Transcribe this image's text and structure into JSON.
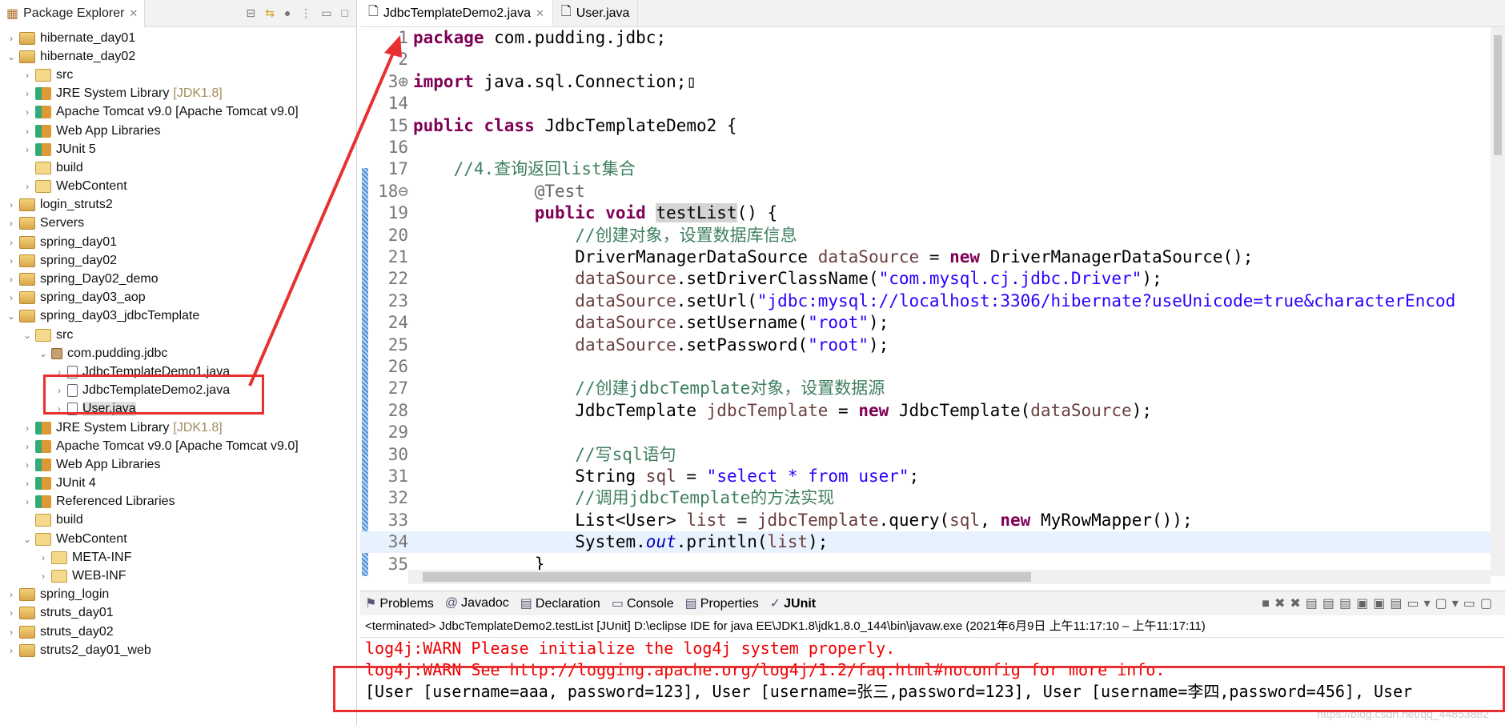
{
  "explorer": {
    "title": "Package Explorer",
    "items": [
      {
        "label": "hibernate_day01",
        "level": 0,
        "tw": ">",
        "icon": "proj"
      },
      {
        "label": "hibernate_day02",
        "level": 0,
        "tw": "v",
        "icon": "proj"
      },
      {
        "label": "src",
        "level": 1,
        "tw": ">",
        "icon": "folder"
      },
      {
        "label": "JRE System Library",
        "extra": "[JDK1.8]",
        "level": 1,
        "tw": ">",
        "icon": "lib"
      },
      {
        "label": "Apache Tomcat v9.0 [Apache Tomcat v9.0]",
        "level": 1,
        "tw": ">",
        "icon": "lib"
      },
      {
        "label": "Web App Libraries",
        "level": 1,
        "tw": ">",
        "icon": "lib"
      },
      {
        "label": "JUnit 5",
        "level": 1,
        "tw": ">",
        "icon": "lib"
      },
      {
        "label": "build",
        "level": 1,
        "tw": "",
        "icon": "folder"
      },
      {
        "label": "WebContent",
        "level": 1,
        "tw": ">",
        "icon": "folder"
      },
      {
        "label": "login_struts2",
        "level": 0,
        "tw": ">",
        "icon": "proj"
      },
      {
        "label": "Servers",
        "level": 0,
        "tw": ">",
        "icon": "proj"
      },
      {
        "label": "spring_day01",
        "level": 0,
        "tw": ">",
        "icon": "proj"
      },
      {
        "label": "spring_day02",
        "level": 0,
        "tw": ">",
        "icon": "proj"
      },
      {
        "label": "spring_Day02_demo",
        "level": 0,
        "tw": ">",
        "icon": "proj"
      },
      {
        "label": "spring_day03_aop",
        "level": 0,
        "tw": ">",
        "icon": "proj"
      },
      {
        "label": "spring_day03_jdbcTemplate",
        "level": 0,
        "tw": "v",
        "icon": "proj"
      },
      {
        "label": "src",
        "level": 1,
        "tw": "v",
        "icon": "folder"
      },
      {
        "label": "com.pudding.jdbc",
        "level": 2,
        "tw": "v",
        "icon": "pkg"
      },
      {
        "label": "JdbcTemplateDemo1.java",
        "level": 3,
        "tw": ">",
        "icon": "java"
      },
      {
        "label": "JdbcTemplateDemo2.java",
        "level": 3,
        "tw": ">",
        "icon": "java"
      },
      {
        "label": "User.java",
        "level": 3,
        "tw": ">",
        "icon": "java",
        "selected": true
      },
      {
        "label": "JRE System Library",
        "extra": "[JDK1.8]",
        "level": 1,
        "tw": ">",
        "icon": "lib"
      },
      {
        "label": "Apache Tomcat v9.0 [Apache Tomcat v9.0]",
        "level": 1,
        "tw": ">",
        "icon": "lib"
      },
      {
        "label": "Web App Libraries",
        "level": 1,
        "tw": ">",
        "icon": "lib"
      },
      {
        "label": "JUnit 4",
        "level": 1,
        "tw": ">",
        "icon": "lib"
      },
      {
        "label": "Referenced Libraries",
        "level": 1,
        "tw": ">",
        "icon": "lib"
      },
      {
        "label": "build",
        "level": 1,
        "tw": "",
        "icon": "folder"
      },
      {
        "label": "WebContent",
        "level": 1,
        "tw": "v",
        "icon": "folder"
      },
      {
        "label": "META-INF",
        "level": 2,
        "tw": ">",
        "icon": "folder"
      },
      {
        "label": "WEB-INF",
        "level": 2,
        "tw": ">",
        "icon": "folder"
      },
      {
        "label": "spring_login",
        "level": 0,
        "tw": ">",
        "icon": "proj"
      },
      {
        "label": "struts_day01",
        "level": 0,
        "tw": ">",
        "icon": "proj"
      },
      {
        "label": "struts_day02",
        "level": 0,
        "tw": ">",
        "icon": "proj"
      },
      {
        "label": "struts2_day01_web",
        "level": 0,
        "tw": ">",
        "icon": "proj"
      }
    ]
  },
  "editor": {
    "tabs": [
      "JdbcTemplateDemo2.java",
      "User.java"
    ],
    "current_line": "34",
    "lines": [
      {
        "n": "1",
        "t": [
          [
            "package",
            "kw"
          ],
          [
            " com.pudding.jdbc;",
            ""
          ]
        ]
      },
      {
        "n": "2",
        "t": []
      },
      {
        "n": "3⊕",
        "t": [
          [
            "import",
            "kw"
          ],
          [
            " java.sql.Connection;▯",
            ""
          ]
        ]
      },
      {
        "n": "14",
        "t": []
      },
      {
        "n": "15",
        "t": [
          [
            "public class",
            "kw"
          ],
          [
            " JdbcTemplateDemo2 {",
            ""
          ]
        ]
      },
      {
        "n": "16",
        "t": []
      },
      {
        "n": "17",
        "t": [
          [
            "    //4.查询返回list集合",
            "cm"
          ]
        ]
      },
      {
        "n": "18⊖",
        "t": [
          [
            "            @Test",
            "ann"
          ]
        ]
      },
      {
        "n": "19",
        "t": [
          [
            "            ",
            ""
          ],
          [
            "public void",
            "kw"
          ],
          [
            " ",
            ""
          ],
          [
            "testList",
            "hl"
          ],
          [
            "() {",
            ""
          ]
        ]
      },
      {
        "n": "20",
        "t": [
          [
            "                //创建对象，设置数据库信息",
            "cm"
          ]
        ]
      },
      {
        "n": "21",
        "t": [
          [
            "                DriverManagerDataSource ",
            ""
          ],
          [
            "dataSource",
            "var"
          ],
          [
            " = ",
            ""
          ],
          [
            "new",
            "kw"
          ],
          [
            " DriverManagerDataSource();",
            ""
          ]
        ]
      },
      {
        "n": "22",
        "t": [
          [
            "                ",
            ""
          ],
          [
            "dataSource",
            "var"
          ],
          [
            ".setDriverClassName(",
            ""
          ],
          [
            "\"com.mysql.cj.jdbc.Driver\"",
            "str"
          ],
          [
            ");",
            ""
          ]
        ]
      },
      {
        "n": "23",
        "t": [
          [
            "                ",
            ""
          ],
          [
            "dataSource",
            "var"
          ],
          [
            ".setUrl(",
            ""
          ],
          [
            "\"jdbc:mysql://localhost:3306/hibernate?useUnicode=true&characterEncod",
            "str"
          ]
        ]
      },
      {
        "n": "24",
        "t": [
          [
            "                ",
            ""
          ],
          [
            "dataSource",
            "var"
          ],
          [
            ".setUsername(",
            ""
          ],
          [
            "\"root\"",
            "str"
          ],
          [
            ");",
            ""
          ]
        ]
      },
      {
        "n": "25",
        "t": [
          [
            "                ",
            ""
          ],
          [
            "dataSource",
            "var"
          ],
          [
            ".setPassword(",
            ""
          ],
          [
            "\"root\"",
            "str"
          ],
          [
            ");",
            ""
          ]
        ]
      },
      {
        "n": "26",
        "t": []
      },
      {
        "n": "27",
        "t": [
          [
            "                //创建jdbcTemplate对象，设置数据源",
            "cm"
          ]
        ]
      },
      {
        "n": "28",
        "t": [
          [
            "                JdbcTemplate ",
            ""
          ],
          [
            "jdbcTemplate",
            "var"
          ],
          [
            " = ",
            ""
          ],
          [
            "new",
            "kw"
          ],
          [
            " JdbcTemplate(",
            ""
          ],
          [
            "dataSource",
            "var"
          ],
          [
            ");",
            ""
          ]
        ]
      },
      {
        "n": "29",
        "t": []
      },
      {
        "n": "30",
        "t": [
          [
            "                //写sql语句",
            "cm"
          ]
        ]
      },
      {
        "n": "31",
        "t": [
          [
            "                String ",
            ""
          ],
          [
            "sql",
            "var"
          ],
          [
            " = ",
            ""
          ],
          [
            "\"select * from user\"",
            "str"
          ],
          [
            ";",
            ""
          ]
        ]
      },
      {
        "n": "32",
        "t": [
          [
            "                //调用jdbcTemplate的方法实现",
            "cm"
          ]
        ]
      },
      {
        "n": "33",
        "t": [
          [
            "                List<User> ",
            ""
          ],
          [
            "list",
            "var"
          ],
          [
            " = ",
            ""
          ],
          [
            "jdbcTemplate",
            "var"
          ],
          [
            ".query(",
            ""
          ],
          [
            "sql",
            "var"
          ],
          [
            ", ",
            ""
          ],
          [
            "new",
            "kw"
          ],
          [
            " MyRowMapper());",
            ""
          ]
        ]
      },
      {
        "n": "34",
        "t": [
          [
            "                System.",
            ""
          ],
          [
            "out",
            "fld"
          ],
          [
            ".println(",
            ""
          ],
          [
            "list",
            "var"
          ],
          [
            ");",
            ""
          ]
        ]
      },
      {
        "n": "35",
        "t": [
          [
            "            }",
            ""
          ]
        ]
      }
    ]
  },
  "console": {
    "tabs": [
      "Problems",
      "Javadoc",
      "Declaration",
      "Console",
      "Properties",
      "JUnit"
    ],
    "active_tab": "JUnit",
    "terminated": "<terminated> JdbcTemplateDemo2.testList [JUnit] D:\\eclipse IDE for java EE\\JDK1.8\\jdk1.8.0_144\\bin\\javaw.exe  (2021年6月9日 上午11:17:10 – 上午11:17:11)",
    "lines": [
      {
        "text": "log4j:WARN Please initialize the log4j system properly.",
        "warn": true
      },
      {
        "text": "log4j:WARN See http://logging.apache.org/log4j/1.2/faq.html#noconfig for more info.",
        "warn": true
      },
      {
        "text": "[User [username=aaa, password=123], User [username=张三,password=123], User [username=李四,password=456], User",
        "warn": false
      }
    ]
  },
  "watermark": "https://blog.csdn.net/qq_44853882",
  "colors": {
    "annotation_red": "#e83030",
    "keyword": "#7f0055",
    "string": "#2a00ff",
    "comment": "#3f7f5f"
  }
}
